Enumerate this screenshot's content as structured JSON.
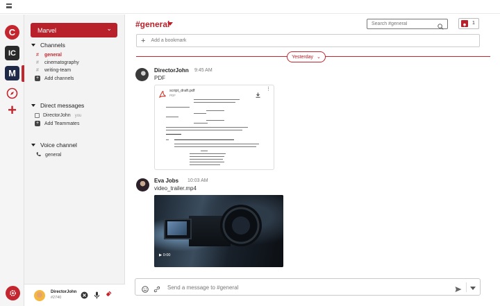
{
  "servers": [
    {
      "initial": "C",
      "color": "#c3262e"
    },
    {
      "initial": "IC",
      "color": "#2a2a2a"
    },
    {
      "initial": "M",
      "color": "#1f2a48"
    }
  ],
  "sidebar": {
    "server_name": "Marvel",
    "channels_heading": "Channels",
    "channels": [
      "general",
      "cinematography",
      "writing-team"
    ],
    "active_channel": "general",
    "add_channels": "Add channels",
    "dm_heading": "Direct messages",
    "dm_user": "DirectorJohn",
    "dm_you": "you",
    "add_teammates": "Add Teammates",
    "voice_heading": "Voice channel",
    "voice_channel": "general"
  },
  "user": {
    "name": "DirectorJohn",
    "tag": "#2740"
  },
  "header": {
    "channel_title": "#general",
    "search_placeholder": "Search #general",
    "member_count": "1"
  },
  "bookmark_label": "Add a bookmark",
  "day_divider": "Yesterday",
  "messages": [
    {
      "author": "DirectorJohn",
      "time": "9:45 AM",
      "text": "PDF",
      "attachment": {
        "name": "script_draft.pdf",
        "type": "PDF"
      }
    },
    {
      "author": "Eva Jobs",
      "time": "10:03 AM",
      "text": "video_trailer.mp4",
      "video_time": "0:00"
    }
  ],
  "composer": {
    "placeholder": "Send a message to #general"
  },
  "accent_color": "#b8212a"
}
